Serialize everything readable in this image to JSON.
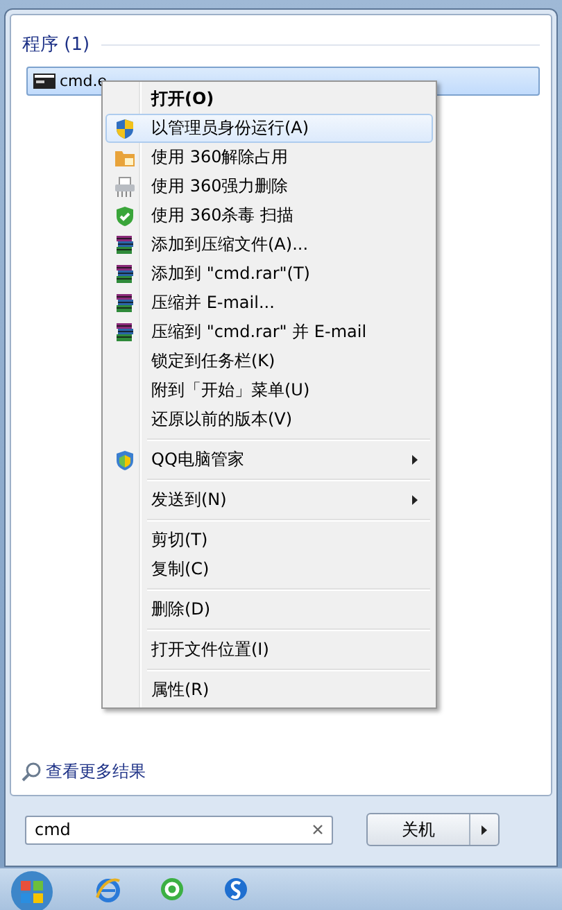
{
  "programs": {
    "heading": "程序 (1)",
    "results": [
      {
        "name": "cmd.e",
        "selected": true
      }
    ]
  },
  "context_menu": {
    "sections": [
      {
        "items": [
          {
            "label": "打开(O)",
            "kind": "plain",
            "default": true,
            "selected": false,
            "submenu": false
          },
          {
            "label": "以管理员身份运行(A)",
            "kind": "shield",
            "default": false,
            "selected": true,
            "submenu": false
          },
          {
            "label": "使用 360解除占用",
            "kind": "folder",
            "default": false,
            "selected": false,
            "submenu": false
          },
          {
            "label": "使用 360强力删除",
            "kind": "shredder",
            "default": false,
            "selected": false,
            "submenu": false
          },
          {
            "label": "使用 360杀毒 扫描",
            "kind": "guard",
            "default": false,
            "selected": false,
            "submenu": false
          },
          {
            "label": "添加到压缩文件(A)...",
            "kind": "archive",
            "default": false,
            "selected": false,
            "submenu": false
          },
          {
            "label": "添加到 \"cmd.rar\"(T)",
            "kind": "archive",
            "default": false,
            "selected": false,
            "submenu": false
          },
          {
            "label": "压缩并 E-mail...",
            "kind": "archive",
            "default": false,
            "selected": false,
            "submenu": false
          },
          {
            "label": "压缩到 \"cmd.rar\" 并 E-mail",
            "kind": "archive",
            "default": false,
            "selected": false,
            "submenu": false
          },
          {
            "label": "锁定到任务栏(K)",
            "kind": "plain",
            "default": false,
            "selected": false,
            "submenu": false
          },
          {
            "label": "附到「开始」菜单(U)",
            "kind": "plain",
            "default": false,
            "selected": false,
            "submenu": false
          },
          {
            "label": "还原以前的版本(V)",
            "kind": "plain",
            "default": false,
            "selected": false,
            "submenu": false
          }
        ]
      },
      {
        "items": [
          {
            "label": "QQ电脑管家",
            "kind": "qq",
            "default": false,
            "selected": false,
            "submenu": true
          }
        ]
      },
      {
        "items": [
          {
            "label": "发送到(N)",
            "kind": "plain",
            "default": false,
            "selected": false,
            "submenu": true
          }
        ]
      },
      {
        "items": [
          {
            "label": "剪切(T)",
            "kind": "plain",
            "default": false,
            "selected": false,
            "submenu": false
          },
          {
            "label": "复制(C)",
            "kind": "plain",
            "default": false,
            "selected": false,
            "submenu": false
          }
        ]
      },
      {
        "items": [
          {
            "label": "删除(D)",
            "kind": "plain",
            "default": false,
            "selected": false,
            "submenu": false
          }
        ]
      },
      {
        "items": [
          {
            "label": "打开文件位置(I)",
            "kind": "plain",
            "default": false,
            "selected": false,
            "submenu": false
          }
        ]
      },
      {
        "items": [
          {
            "label": "属性(R)",
            "kind": "plain",
            "default": false,
            "selected": false,
            "submenu": false
          }
        ]
      }
    ]
  },
  "more_results": "查看更多结果",
  "search": {
    "value": "cmd"
  },
  "shutdown_button": "关机",
  "taskbar": {
    "pinned": [
      {
        "kind": "ie"
      },
      {
        "kind": "green-browser"
      },
      {
        "kind": "sogou"
      }
    ]
  }
}
